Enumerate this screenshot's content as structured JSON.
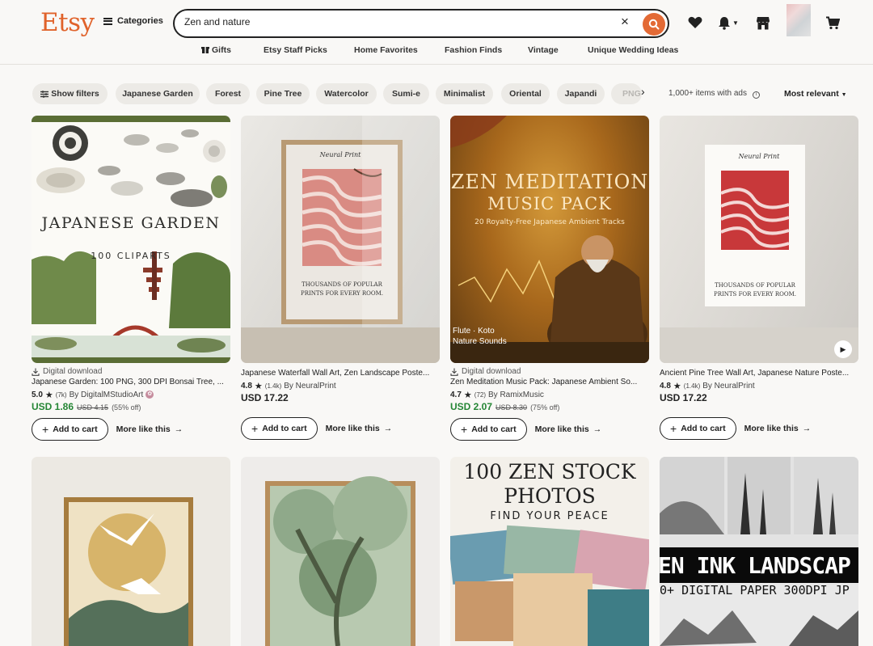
{
  "header": {
    "logo": "Etsy",
    "categories_label": "Categories",
    "search_value": "Zen and nature"
  },
  "subnav": [
    "Gifts",
    "Etsy Staff Picks",
    "Home Favorites",
    "Fashion Finds",
    "Vintage",
    "Unique Wedding Ideas"
  ],
  "filters": {
    "show_filters": "Show filters",
    "chips": [
      "Japanese Garden",
      "Forest",
      "Pine Tree",
      "Watercolor",
      "Sumi-e",
      "Minimalist",
      "Oriental",
      "Japandi",
      "PNG"
    ],
    "count": "1,000+ items with ads",
    "sort": "Most relevant"
  },
  "products": [
    {
      "meta": "Digital download",
      "title": "Japanese Garden: 100 PNG, 300 DPI Bonsai Tree, ...",
      "rating": "5.0",
      "reviews": "(7k)",
      "shop": "By DigitalMStudioArt",
      "price": "USD 1.86",
      "orig_price": "USD 4.15",
      "discount": "(55% off)",
      "image_text": {
        "heading": "JAPANESE GARDEN",
        "sub": "100 CLIPARTS"
      }
    },
    {
      "meta": "",
      "title": "Japanese Waterfall Wall Art, Zen Landscape Poste...",
      "rating": "4.8",
      "reviews": "(1.4k)",
      "shop": "By NeuralPrint",
      "price": "USD 17.22",
      "image_text": {
        "brand": "Neural Print",
        "caption": "THOUSANDS OF POPULAR PRINTS FOR EVERY ROOM."
      }
    },
    {
      "meta": "Digital download",
      "title": "Zen Meditation Music Pack: Japanese Ambient So...",
      "rating": "4.7",
      "reviews": "(72)",
      "shop": "By RamixMusic",
      "price": "USD 2.07",
      "orig_price": "USD 8.30",
      "discount": "(75% off)",
      "image_text": {
        "heading1": "ZEN MEDITATION",
        "heading2": "MUSIC PACK",
        "sub": "20 Royalty-Free Japanese Ambient Tracks",
        "tag1": "Flute · Koto",
        "tag2": "Nature Sounds"
      }
    },
    {
      "meta": "",
      "title": "Ancient Pine Tree Wall Art, Japanese Nature Poste...",
      "rating": "4.8",
      "reviews": "(1.4k)",
      "shop": "By NeuralPrint",
      "price": "USD 17.22",
      "image_text": {
        "brand": "Neural Print",
        "caption": "THOUSANDS OF POPULAR PRINTS FOR EVERY ROOM."
      }
    }
  ],
  "second_row": {
    "card3": {
      "line1": "100 ZEN STOCK",
      "line2": "PHOTOS",
      "line3": "FIND YOUR PEACE"
    },
    "card4": {
      "line1": "EN INK LANDSCAP",
      "line2": "0+ DIGITAL PAPER 300DPI JP"
    }
  },
  "labels": {
    "add_to_cart": "Add to cart",
    "more_like_this": "More like this"
  }
}
